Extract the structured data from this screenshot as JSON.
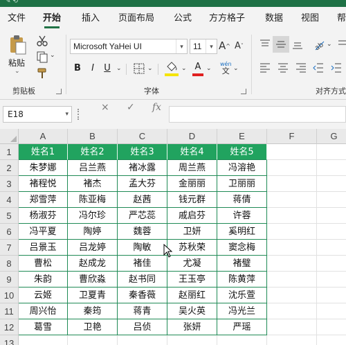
{
  "menu": {
    "tabs": [
      "文件",
      "开始",
      "插入",
      "页面布局",
      "公式",
      "方方格子",
      "数据",
      "视图",
      "帮"
    ],
    "active": "开始"
  },
  "ribbon": {
    "clipboard": {
      "paste_label": "粘贴",
      "group_label": "剪贴板"
    },
    "font": {
      "font_name": "Microsoft YaHei UI",
      "font_size": "11",
      "bold": "B",
      "italic": "I",
      "underline": "U",
      "phonetic_top": "wén",
      "phonetic_bottom": "文",
      "font_color_letter": "A",
      "fill_color": "#f5e400",
      "font_color": "#e02020",
      "group_label": "字体"
    },
    "alignment": {
      "group_label": "对齐方式"
    }
  },
  "formula_bar": {
    "cell_ref": "E18",
    "cancel": "×",
    "confirm": "✓",
    "fx": "fx",
    "value": ""
  },
  "sheet": {
    "columns": [
      "A",
      "B",
      "C",
      "D",
      "E",
      "F",
      "G"
    ],
    "rows": [
      "1",
      "2",
      "3",
      "4",
      "5",
      "6",
      "7",
      "8",
      "9",
      "10",
      "11",
      "12",
      "13"
    ],
    "header": [
      "姓名1",
      "姓名2",
      "姓名3",
      "姓名4",
      "姓名5"
    ],
    "data": [
      [
        "朱梦娜",
        "吕兰燕",
        "褚冰露",
        "周兰燕",
        "冯溶艳"
      ],
      [
        "褚程悦",
        "褚杰",
        "孟大芬",
        "金丽丽",
        "卫丽丽"
      ],
      [
        "郑雪萍",
        "陈亚梅",
        "赵茜",
        "钱元群",
        "蒋倩"
      ],
      [
        "杨淑芬",
        "冯尔珍",
        "严芯蕊",
        "戚启芬",
        "许蓉"
      ],
      [
        "冯平夏",
        "陶婷",
        "魏蓉",
        "卫妍",
        "奚明红"
      ],
      [
        "吕景玉",
        "吕龙婷",
        "陶敏",
        "苏秋荣",
        "窦念梅"
      ],
      [
        "曹松",
        "赵成龙",
        "褚佳",
        "尤凝",
        "褚璧"
      ],
      [
        "朱韵",
        "曹欣淼",
        "赵书同",
        "王玉亭",
        "陈黄萍"
      ],
      [
        "云姬",
        "卫夏青",
        "秦香薇",
        "赵丽红",
        "沈乐萱"
      ],
      [
        "周兴怡",
        "秦筠",
        "蒋青",
        "吴火英",
        "冯光兰"
      ],
      [
        "葛雪",
        "卫艳",
        "吕侦",
        "张妍",
        "严瑶"
      ]
    ],
    "table_header_color": "#21a35f",
    "table_border_color": "#1f8a55"
  }
}
